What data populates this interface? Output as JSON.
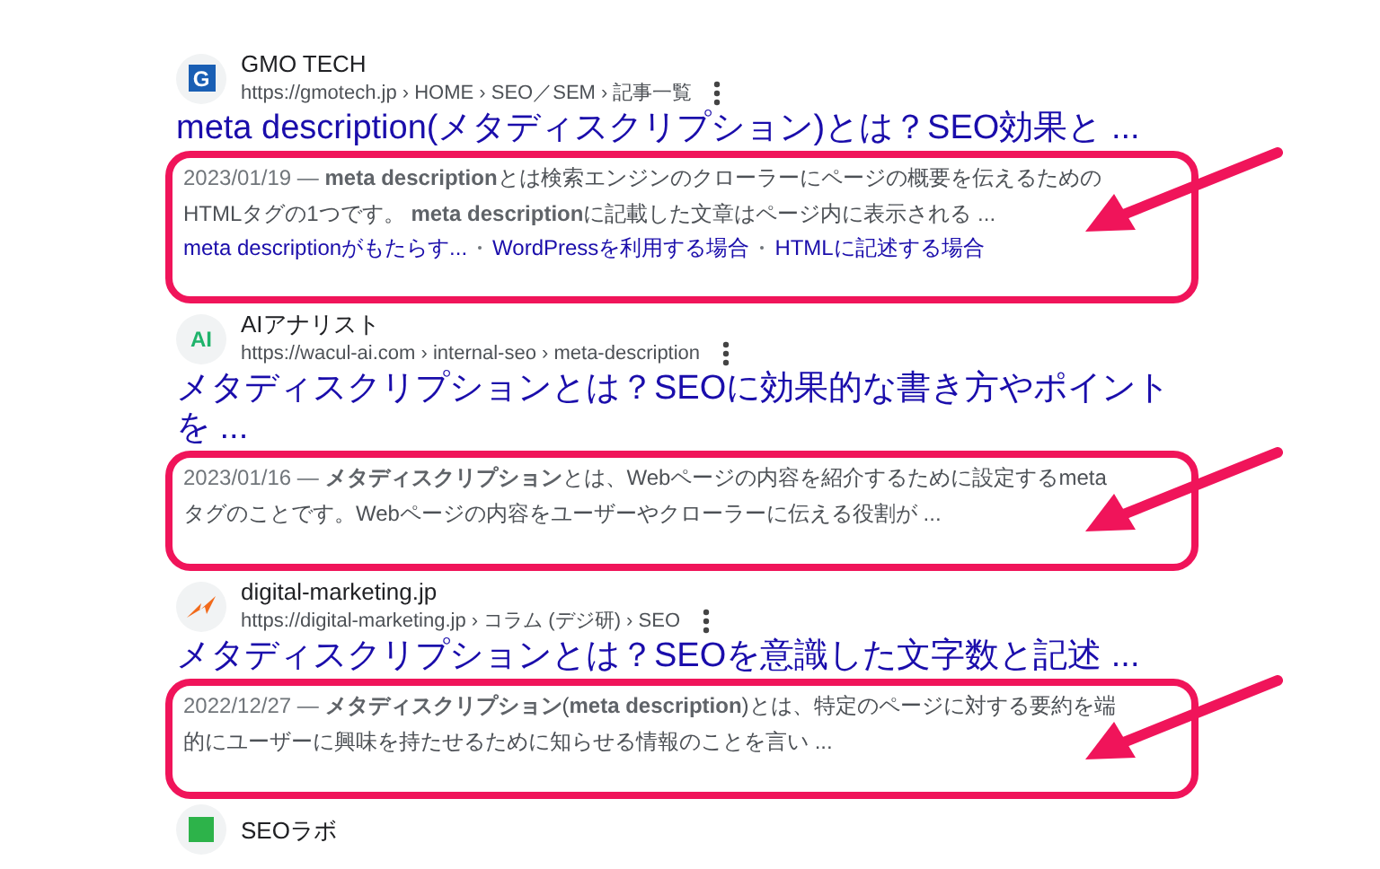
{
  "results": [
    {
      "favicon": {
        "kind": "square",
        "text": "G"
      },
      "site": "GMO TECH",
      "url": "https://gmotech.jp › HOME › SEO／SEM › 記事一覧",
      "title": "meta description(メタディスクリプション)とは？SEO効果と ...",
      "date": "2023/01/19 —",
      "snippet": "**meta description**とは検索エンジンのクローラーにページの概要を伝えるための HTMLタグの1つです。 **meta description**に記載した文章はページ内に表示される ...",
      "links": [
        "meta descriptionがもたらす...",
        "WordPressを利用する場合",
        "HTMLに記述する場合"
      ],
      "highlighted": true
    },
    {
      "favicon": {
        "kind": "letters",
        "text": "AI"
      },
      "site": "AIアナリスト",
      "url": "https://wacul-ai.com › internal-seo › meta-description",
      "title": "メタディスクリプションとは？SEOに効果的な書き方やポイントを ...",
      "date": "2023/01/16 —",
      "snippet": "**メタディスクリプション**とは、Webページの内容を紹介するために設定するmetaタグのことです。Webページの内容をユーザーやクローラーに伝える役割が ...",
      "highlighted": true
    },
    {
      "favicon": {
        "kind": "flame"
      },
      "site": "digital-marketing.jp",
      "url": "https://digital-marketing.jp › コラム (デジ研) › SEO",
      "title": "メタディスクリプションとは？SEOを意識した文字数と記述 ...",
      "date": "2022/12/27 —",
      "snippet": "**メタディスクリプション**(**meta description**)とは、特定のページに対する要約を端的にユーザーに興味を持たせるために知らせる情報のことを言い ...",
      "highlighted": true
    },
    {
      "favicon": {
        "kind": "green"
      },
      "site": "SEOラボ"
    }
  ]
}
